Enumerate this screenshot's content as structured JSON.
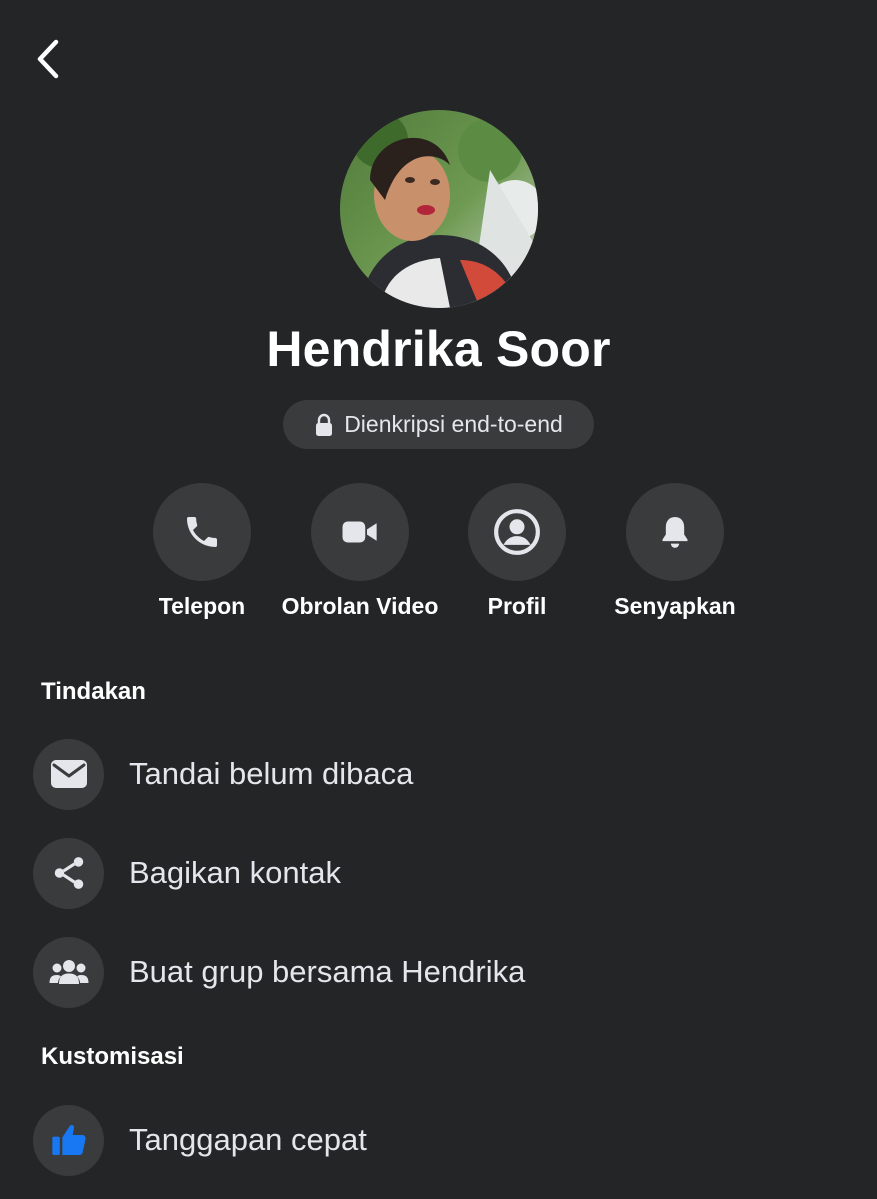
{
  "profile": {
    "name": "Hendrika Soor",
    "encryption_label": "Dienkripsi end-to-end",
    "avatar_icon": "profile-photo"
  },
  "quick_actions": [
    {
      "label": "Telepon",
      "icon": "phone-icon"
    },
    {
      "label": "Obrolan Video",
      "icon": "video-camera-icon"
    },
    {
      "label": "Profil",
      "icon": "user-circle-icon"
    },
    {
      "label": "Senyapkan",
      "icon": "bell-icon"
    }
  ],
  "sections": {
    "actions_title": "Tindakan",
    "actions": [
      {
        "label": "Tandai belum dibaca",
        "icon": "envelope-icon"
      },
      {
        "label": "Bagikan kontak",
        "icon": "share-icon"
      },
      {
        "label": "Buat grup bersama Hendrika",
        "icon": "group-icon"
      }
    ],
    "customization_title": "Kustomisasi",
    "customization": [
      {
        "label": "Tanggapan cepat",
        "icon": "thumbs-up-icon",
        "color": "#1877f2"
      }
    ]
  },
  "colors": {
    "background": "#242526",
    "surface": "#3a3b3c",
    "text": "#e4e6eb",
    "accent": "#1877f2"
  }
}
